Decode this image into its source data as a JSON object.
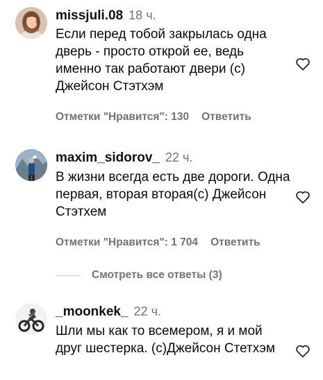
{
  "comments": [
    {
      "username": "missjuli.08",
      "time": "18 ч.",
      "text": "Если перед тобой закрылась одна дверь - просто открой ее, ведь именно так работают двери (с) Джейсон Стэтхэм",
      "likes_label": "Отметки \"Нравится\": 130",
      "reply_label": "Ответить"
    },
    {
      "username": "maxim_sidorov_",
      "time": "22 ч.",
      "text": "В жизни всегда есть две дороги. Одна первая, вторая вторая(с) Джейсон Стэтхем",
      "likes_label": "Отметки \"Нравится\": 1 704",
      "reply_label": "Ответить"
    },
    {
      "username": "_moonkek_",
      "time": "22 ч.",
      "text": "Шли мы как то всемером, я и мой друг шестерка. (с)Джейсон Стетхэм",
      "likes_label": "",
      "reply_label": ""
    }
  ],
  "view_replies_label": "Смотреть все ответы (3)"
}
